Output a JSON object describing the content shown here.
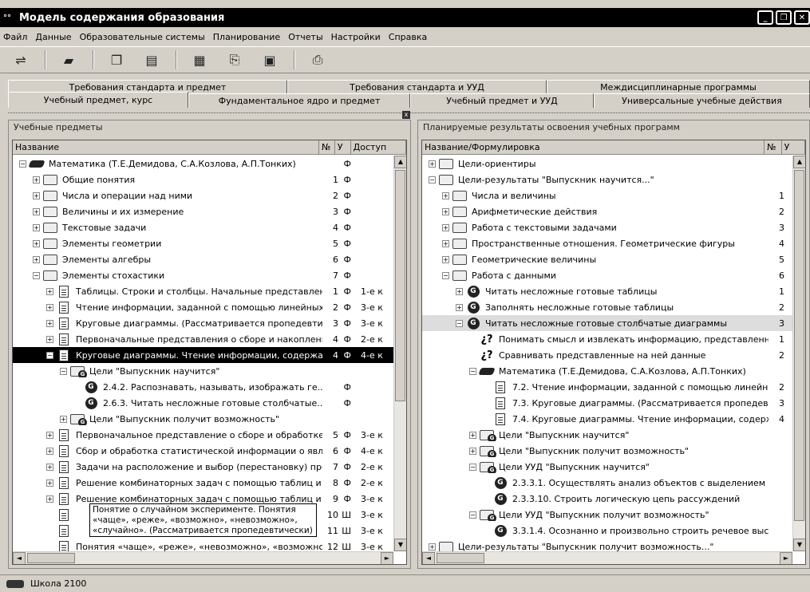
{
  "window": {
    "title": "Модель содержания образования",
    "app_icon": "°°"
  },
  "menu": [
    "Файл",
    "Данные",
    "Образовательные системы",
    "Планирование",
    "Отчеты",
    "Настройки",
    "Справка"
  ],
  "toolbar_icons": [
    "connect-icon",
    "book-icon",
    "copy-icon",
    "table-icon",
    "calc-icon",
    "export-icon",
    "doc-icon",
    "print-icon"
  ],
  "tabs_row1": [
    "Требования стандарта и предмет",
    "Требования стандарта и УУД",
    "Междисциплинарные программы"
  ],
  "tabs_row2": [
    "Учебный предмет, курс",
    "Фундаментальное ядро и предмет",
    "Учебный предмет и УУД",
    "Универсальные учебные действия"
  ],
  "left": {
    "title": "Учебные предметы",
    "cols": [
      "Название",
      "№",
      "У",
      "Доступ"
    ],
    "rows": [
      {
        "t": "Математика (Т.Е.Демидова, С.А.Козлова, А.П.Тонких)",
        "n": "",
        "u": "Ф",
        "d": "",
        "i": "book",
        "lv": 0,
        "e": "-"
      },
      {
        "t": "Общие понятия",
        "n": "1",
        "u": "Ф",
        "d": "",
        "i": "folder",
        "lv": 1,
        "e": "+"
      },
      {
        "t": "Числа и операции над ними",
        "n": "2",
        "u": "Ф",
        "d": "",
        "i": "folder",
        "lv": 1,
        "e": "+"
      },
      {
        "t": "Величины и их измерение",
        "n": "3",
        "u": "Ф",
        "d": "",
        "i": "folder",
        "lv": 1,
        "e": "+"
      },
      {
        "t": "Текстовые задачи",
        "n": "4",
        "u": "Ф",
        "d": "",
        "i": "folder",
        "lv": 1,
        "e": "+"
      },
      {
        "t": "Элементы геометрии",
        "n": "5",
        "u": "Ф",
        "d": "",
        "i": "folder",
        "lv": 1,
        "e": "+"
      },
      {
        "t": "Элементы алгебры",
        "n": "6",
        "u": "Ф",
        "d": "",
        "i": "folder",
        "lv": 1,
        "e": "+"
      },
      {
        "t": "Элементы стохастики",
        "n": "7",
        "u": "Ф",
        "d": "",
        "i": "folder",
        "lv": 1,
        "e": "-"
      },
      {
        "t": "Таблицы. Строки и столбцы. Начальные представлен...",
        "n": "1",
        "u": "Ф",
        "d": "1-е к",
        "i": "doc",
        "lv": 2,
        "e": "+"
      },
      {
        "t": "Чтение информации, заданной с помощью линейных и...",
        "n": "2",
        "u": "Ф",
        "d": "3-е к",
        "i": "doc",
        "lv": 2,
        "e": "+"
      },
      {
        "t": "Круговые диаграммы. (Рассматривается пропедевтич...",
        "n": "3",
        "u": "Ф",
        "d": "3-е к",
        "i": "doc",
        "lv": 2,
        "e": "+"
      },
      {
        "t": "Первоначальные представления о сборе и накоплени...",
        "n": "4",
        "u": "Ф",
        "d": "2-е к",
        "i": "doc",
        "lv": 2,
        "e": "+"
      },
      {
        "t": "Круговые диаграммы. Чтение информации, содержащ...",
        "n": "4",
        "u": "Ф",
        "d": "4-е к",
        "i": "doc",
        "lv": 2,
        "e": "-",
        "sel": true
      },
      {
        "t": "Цели \"Выпускник научится\"",
        "n": "",
        "u": "",
        "d": "",
        "i": "goalfolder",
        "lv": 3,
        "e": "-"
      },
      {
        "t": "2.4.2. Распознавать, называть, изображать ге...",
        "n": "",
        "u": "Ф",
        "d": "",
        "i": "goal",
        "lv": 4,
        "e": ""
      },
      {
        "t": "2.6.3. Читать несложные готовые столбчатые...",
        "n": "",
        "u": "Ф",
        "d": "",
        "i": "goal",
        "lv": 4,
        "e": ""
      },
      {
        "t": "Цели \"Выпускник получит возможность\"",
        "n": "",
        "u": "",
        "d": "",
        "i": "goalfolder",
        "lv": 3,
        "e": "+"
      },
      {
        "t": "Первоначальное представление о сборе и обработке ...",
        "n": "5",
        "u": "Ф",
        "d": "3-е к",
        "i": "doc",
        "lv": 2,
        "e": "+"
      },
      {
        "t": "Сбор и обработка статистической информации о явле...",
        "n": "6",
        "u": "Ф",
        "d": "4-е к",
        "i": "doc",
        "lv": 2,
        "e": "+"
      },
      {
        "t": "Задачи на расположение и выбор (перестановку) пре...",
        "n": "7",
        "u": "Ф",
        "d": "2-е к",
        "i": "doc",
        "lv": 2,
        "e": "+"
      },
      {
        "t": "Решение комбинаторных задач с помощью таблиц и г...",
        "n": "8",
        "u": "Ф",
        "d": "2-е к",
        "i": "doc",
        "lv": 2,
        "e": "+"
      },
      {
        "t": "Решение комбинаторных задач с помощью таблиц и г...",
        "n": "9",
        "u": "Ф",
        "d": "3-е к",
        "i": "doc",
        "lv": 2,
        "e": "+"
      },
      {
        "t": "",
        "n": "10",
        "u": "Ш",
        "d": "3-е к",
        "i": "docinfo",
        "lv": 2,
        "e": ""
      },
      {
        "t": "",
        "n": "11",
        "u": "Ш",
        "d": "3-е к",
        "i": "docinfo",
        "lv": 2,
        "e": ""
      },
      {
        "t": "Понятия «чаще», «реже», «невозможно», «возможно»...",
        "n": "12",
        "u": "Ш",
        "d": "3-е к",
        "i": "docinfo",
        "lv": 2,
        "e": ""
      }
    ],
    "tooltip": "Понятие о случайном эксперименте. Понятия «чаще», «реже», «возможно», «невозможно», «случайно». (Рассматривается пропедевтически)"
  },
  "right": {
    "title": "Планируемые результаты освоения учебных программ",
    "cols": [
      "Название/Формулировка",
      "№",
      "У"
    ],
    "rows": [
      {
        "t": "Цели-ориентиры",
        "n": "",
        "i": "folder",
        "lv": 0,
        "e": "+"
      },
      {
        "t": "Цели-результаты \"Выпускник научится...\"",
        "n": "",
        "i": "folder",
        "lv": 0,
        "e": "-"
      },
      {
        "t": "Числа и величины",
        "n": "1",
        "i": "folder",
        "lv": 1,
        "e": "+"
      },
      {
        "t": "Арифметические действия",
        "n": "2",
        "i": "folder",
        "lv": 1,
        "e": "+"
      },
      {
        "t": "Работа с текстовыми задачами",
        "n": "3",
        "i": "folder",
        "lv": 1,
        "e": "+"
      },
      {
        "t": "Пространственные отношения. Геометрические фигуры",
        "n": "4",
        "i": "folder",
        "lv": 1,
        "e": "+"
      },
      {
        "t": "Геометрические величины",
        "n": "5",
        "i": "folder",
        "lv": 1,
        "e": "+"
      },
      {
        "t": "Работа с данными",
        "n": "6",
        "i": "folder",
        "lv": 1,
        "e": "-"
      },
      {
        "t": "Читать несложные готовые таблицы",
        "n": "1",
        "i": "goal",
        "lv": 2,
        "e": "+"
      },
      {
        "t": "Заполнять несложные готовые таблицы",
        "n": "2",
        "i": "goal",
        "lv": 2,
        "e": "+"
      },
      {
        "t": "Читать несложные готовые столбчатые диаграммы",
        "n": "3",
        "i": "goal",
        "lv": 2,
        "e": "-",
        "hl": true
      },
      {
        "t": "Понимать смысл и извлекать информацию, представленну...",
        "n": "1",
        "i": "q",
        "lv": 3,
        "e": ""
      },
      {
        "t": "Сравнивать представленные на ней данные",
        "n": "2",
        "i": "q",
        "lv": 3,
        "e": ""
      },
      {
        "t": "Математика (Т.Е.Демидова, С.А.Козлова, А.П.Тонких)",
        "n": "",
        "i": "book",
        "lv": 3,
        "e": "-"
      },
      {
        "t": "7.2. Чтение информации, заданной с помощью линейных...",
        "n": "2",
        "i": "doc",
        "lv": 4,
        "e": ""
      },
      {
        "t": "7.3. Круговые диаграммы. (Рассматривается пропедевт...",
        "n": "3",
        "i": "doc",
        "lv": 4,
        "e": ""
      },
      {
        "t": "7.4. Круговые диаграммы. Чтение информации, содержа...",
        "n": "4",
        "i": "doc",
        "lv": 4,
        "e": ""
      },
      {
        "t": "Цели \"Выпускник научится\"",
        "n": "",
        "i": "goalfolder",
        "lv": 3,
        "e": "+"
      },
      {
        "t": "Цели \"Выпускник получит возможность\"",
        "n": "",
        "i": "goalfolder",
        "lv": 3,
        "e": "+"
      },
      {
        "t": "Цели УУД \"Выпускник научится\"",
        "n": "",
        "i": "goalfolder",
        "lv": 3,
        "e": "-"
      },
      {
        "t": "2.3.3.1. Осуществлять анализ объектов с выделением с...",
        "n": "",
        "i": "goal",
        "lv": 4,
        "e": ""
      },
      {
        "t": "2.3.3.10. Строить логическую цепь рассуждений",
        "n": "",
        "i": "goal",
        "lv": 4,
        "e": ""
      },
      {
        "t": "Цели УУД \"Выпускник получит возможность\"",
        "n": "",
        "i": "goalfolder",
        "lv": 3,
        "e": "-"
      },
      {
        "t": "3.3.1.4. Осознанно и произвольно строить речевое выс...",
        "n": "",
        "i": "goal",
        "lv": 4,
        "e": ""
      },
      {
        "t": "Цели-результаты \"Выпускник получит возможность...\"",
        "n": "",
        "i": "folder",
        "lv": 0,
        "e": "+"
      }
    ]
  },
  "status": {
    "text": "Школа 2100"
  }
}
